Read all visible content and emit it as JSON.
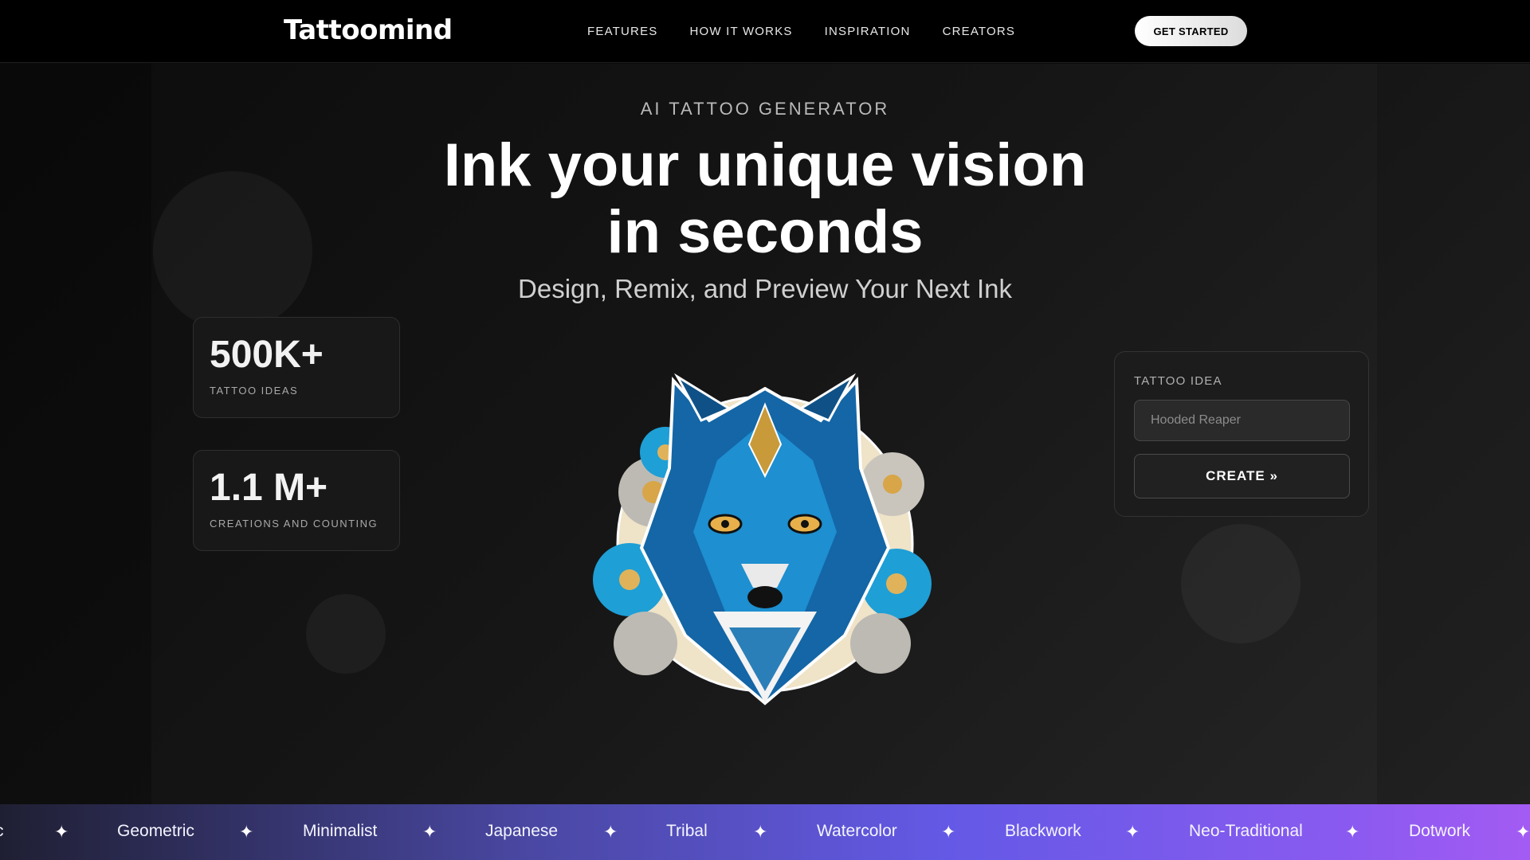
{
  "brand": {
    "logo": "Tattoomind"
  },
  "nav": {
    "links": [
      "FEATURES",
      "HOW IT WORKS",
      "INSPIRATION",
      "CREATORS"
    ],
    "cta_label": "GET STARTED"
  },
  "hero": {
    "eyebrow": "AI TATTOO GENERATOR",
    "headline_line1": "Ink your unique vision",
    "headline_line2": "in seconds",
    "subheadline": "Design, Remix, and Preview Your Next Ink"
  },
  "stats": [
    {
      "value": "500K+",
      "label": "TATTOO IDEAS"
    },
    {
      "value": "1.1 M+",
      "label": "CREATIONS AND COUNTING"
    }
  ],
  "generator": {
    "field_label": "TATTOO IDEA",
    "input_placeholder": "Hooded Reaper",
    "input_value": "",
    "create_label": "CREATE »"
  },
  "styles_marquee": {
    "items": [
      "c",
      "Geometric",
      "Minimalist",
      "Japanese",
      "Tribal",
      "Watercolor",
      "Blackwork",
      "Neo-Traditional",
      "Dotwork"
    ],
    "separator": "✦"
  },
  "icons": {
    "marquee_separator": "sparkle-icon",
    "showcase_image": "wolf-tattoo-illustration"
  },
  "colors": {
    "page_bg": "#0b0b0b",
    "nav_bg": "#000000",
    "marquee_gradient": [
      "#1f1f33",
      "#6459e6",
      "#a35bf3"
    ],
    "wolf_blue": "#1e8fd0",
    "wolf_gold": "#c99a3a"
  }
}
